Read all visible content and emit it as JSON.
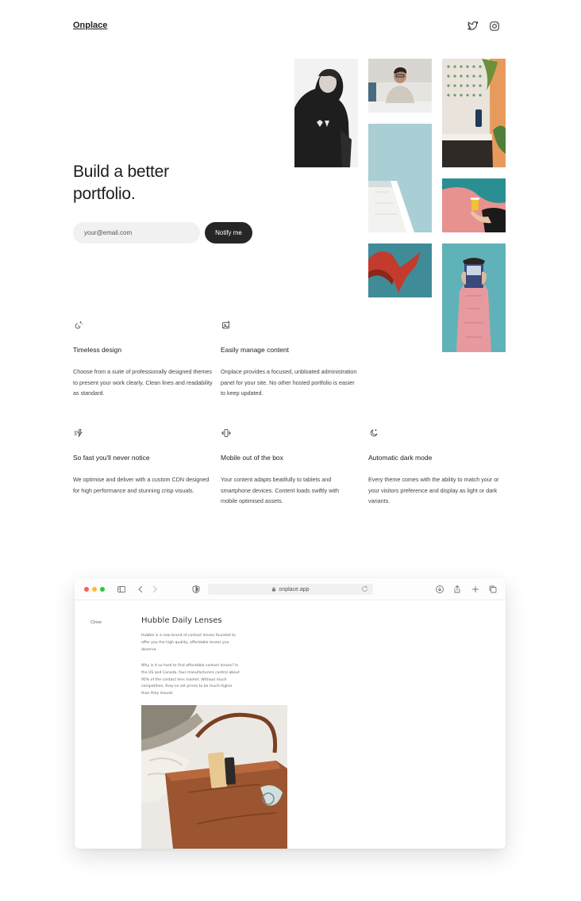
{
  "header": {
    "logo": "Onplace",
    "social": [
      {
        "name": "twitter-icon"
      },
      {
        "name": "instagram-icon"
      }
    ]
  },
  "hero": {
    "title_line1": "Build a better",
    "title_line2": "portfolio.",
    "email_placeholder": "your@email.com",
    "notify_label": "Notify me"
  },
  "features": [
    {
      "icon": "palette-sparkle-icon",
      "title": "Timeless design",
      "desc": "Choose from a suite of professionally designed themes to present your work clearly. Clean lines and readability as standard."
    },
    {
      "icon": "image-edit-icon",
      "title": "Easily manage content",
      "desc": "Onplace provides a focused, unbloated administration panel for your site. No other hosted portfolio is easier to keep updated."
    },
    {
      "icon": "lightning-fast-icon",
      "title": "So fast you'll never notice",
      "desc": "We optimise and deliver with a custom CDN designed for high performance and stunning crisp visuals."
    },
    {
      "icon": "mobile-vibrate-icon",
      "title": "Mobile out of the box",
      "desc": "Your content adapts beatifully to tablets and smartphone devices. Content loads swiftly with mobile optimised assets."
    },
    {
      "icon": "moon-stars-icon",
      "title": "Automatic dark mode",
      "desc": "Every theme comes with the ability to match your or your visitors preference and display as light or dark variants."
    }
  ],
  "browser": {
    "url": "onplace.app",
    "close_label": "Close",
    "doc_title": "Hubble Daily Lenses",
    "doc_p1": "Hubble is a new brand of contact lenses founded to offer you the high quality, affordable lenses you deserve.",
    "doc_p2": "Why is it so hard to find affordable contact lenses? In the US and Canada, four manufacturers control about 95% of the contact lens market. Without much competition, they've set prices to be much higher than they should.",
    "traffic_colors": [
      "#ff5f57",
      "#febc2e",
      "#28c840"
    ]
  }
}
